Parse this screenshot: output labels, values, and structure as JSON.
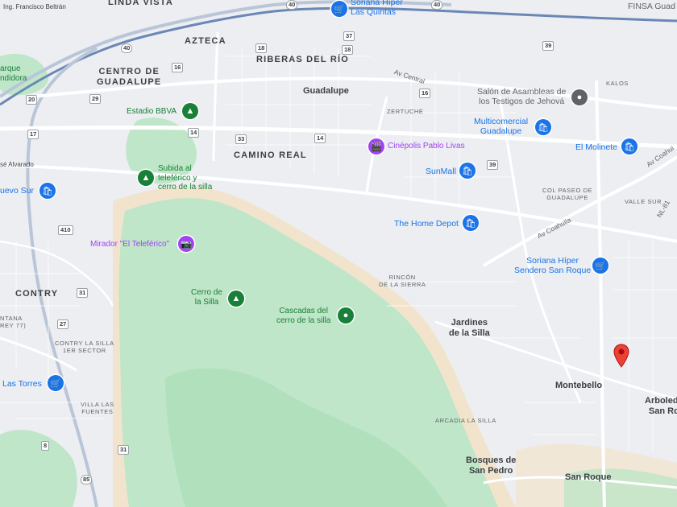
{
  "map": {
    "colors": {
      "land": "#eceef1",
      "park": "#bfe6c8",
      "park_dark": "#a8dcb5",
      "sand": "#f2e4cc",
      "road": "#ffffff",
      "highway": "#b9c6d8",
      "water_road_blue": "#6b87b6",
      "poi_blue": "#1a73e8",
      "poi_green": "#188038",
      "poi_purple": "#a142f4",
      "marker": "#ea4335"
    },
    "neighborhoods": {
      "linda_vista": "LINDA VISTA",
      "azteca": "AZTECA",
      "riberas": "RIBERAS DEL RÍO",
      "centro_1": "CENTRO DE",
      "centro_2": "GUADALUPE",
      "camino_real": "CAMINO REAL",
      "contry": "CONTRY",
      "zertuche": "ZERTUCHE",
      "kalos": "KALOS",
      "col_paseo_1": "COL PASEO DE",
      "col_paseo_2": "GUADALUPE",
      "valle_sur": "VALLE SUR",
      "rincon_1": "RINCÓN",
      "rincon_2": "DE LA SIERRA",
      "contry_silla_1": "CONTRY LA SILLA",
      "contry_silla_2": "1ER SECTOR",
      "villa_fuentes_1": "VILLA LAS",
      "villa_fuentes_2": "FUENTES",
      "arcadia": "ARCADIA LA SILLA",
      "tantana_1": "NTANA",
      "tantana_2": "REY 77)"
    },
    "places": {
      "guadalupe": "Guadalupe",
      "jardines_1": "Jardines",
      "jardines_2": "de la Silla",
      "montebello": "Montebello",
      "arboleda_1": "Arboleda",
      "arboleda_2": "San Ro",
      "bosques_1": "Bosques de",
      "bosques_2": "San Pedro",
      "san_roque": "San Roque",
      "ing_francisco": "Ing. Francisco Beltrán",
      "jose_alvarado": "sé Alvarado",
      "parque_1": "arque",
      "parque_2": "ndidora"
    },
    "pois": {
      "soriana_quintas_1": "Soriana Híper",
      "soriana_quintas_2": "Las Quintas",
      "finsa": "FINSA Guad",
      "salon_1": "Salón de Asambleas de",
      "salon_2": "los Testigos de Jehová",
      "estadio": "Estadio BBVA",
      "multicomercial_1": "Multicomercial",
      "multicomercial_2": "Guadalupe",
      "cinepolis": "Cinépolis Pablo Livas",
      "molinete": "El Molinete",
      "subida_1": "Subida al",
      "subida_2": "teleférico y",
      "subida_3": "cerro de la silla",
      "sunmall": "SunMall",
      "nuevo_sur": "uevo Sur",
      "mirador": "Mirador \"El Teleférico\"",
      "home_depot": "The Home Depot",
      "soriana_sendero_1": "Soriana Híper",
      "soriana_sendero_2": "Sendero San Roque",
      "cerro_1": "Cerro de",
      "cerro_2": "la Silla",
      "cascadas_1": "Cascadas del",
      "cascadas_2": "cerro de la silla",
      "las_torres": "Las Torres"
    },
    "roads": {
      "av_central": "Av Central",
      "av_coahuila": "Av Coahuila",
      "av_coahuila_2": "Av Coahui",
      "nl_81": "NL-81"
    },
    "shields": [
      "40",
      "40",
      "40",
      "40",
      "37",
      "18",
      "18",
      "16",
      "16",
      "29",
      "20",
      "14",
      "33",
      "14",
      "17",
      "39",
      "39",
      "410",
      "31",
      "27",
      "8",
      "31",
      "85"
    ]
  }
}
